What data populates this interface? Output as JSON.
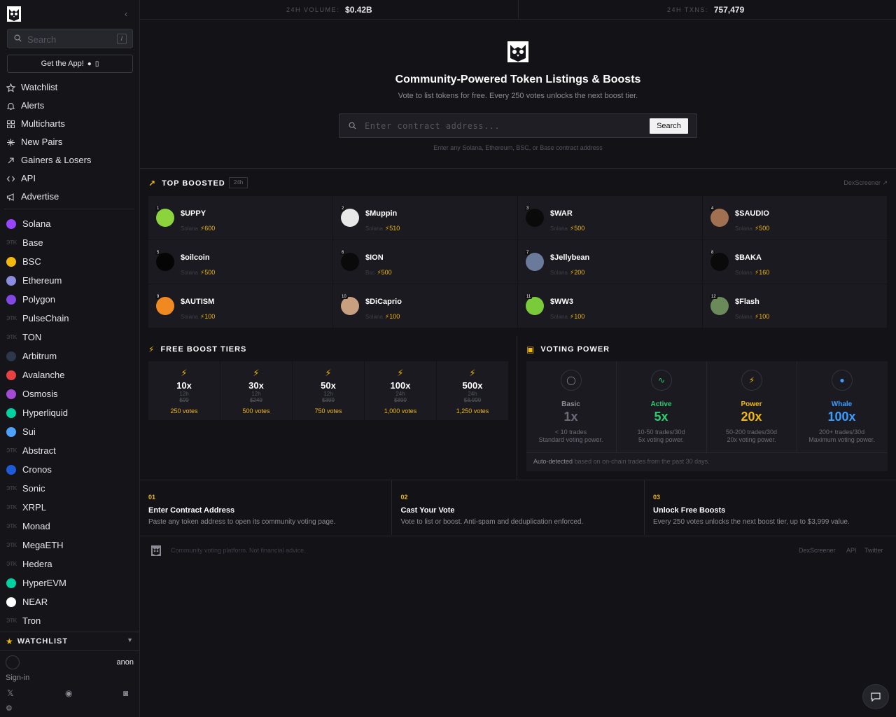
{
  "sidebar": {
    "search_placeholder": "Search",
    "search_shortcut": "/",
    "get_app_label": "Get the App!",
    "nav": [
      {
        "label": "Watchlist",
        "icon": "star-icon"
      },
      {
        "label": "Alerts",
        "icon": "bell-icon"
      },
      {
        "label": "Multicharts",
        "icon": "grid-icon"
      },
      {
        "label": "New Pairs",
        "icon": "sparkle-icon"
      },
      {
        "label": "Gainers & Losers",
        "icon": "arrow-up-right-icon"
      },
      {
        "label": "API",
        "icon": "code-icon"
      },
      {
        "label": "Advertise",
        "icon": "megaphone-icon"
      }
    ],
    "chains": [
      {
        "label": "Solana",
        "color": "#9945ff"
      },
      {
        "label": "Base",
        "color": ""
      },
      {
        "label": "BSC",
        "color": "#f0b90b"
      },
      {
        "label": "Ethereum",
        "color": "#8c8ce0"
      },
      {
        "label": "Polygon",
        "color": "#8247e5"
      },
      {
        "label": "PulseChain",
        "color": ""
      },
      {
        "label": "TON",
        "color": ""
      },
      {
        "label": "Arbitrum",
        "color": "#2d374b"
      },
      {
        "label": "Avalanche",
        "color": "#e84142"
      },
      {
        "label": "Osmosis",
        "color": "#a34bd4"
      },
      {
        "label": "Hyperliquid",
        "color": "#00d1a0"
      },
      {
        "label": "Sui",
        "color": "#4da2ff"
      },
      {
        "label": "Abstract",
        "color": ""
      },
      {
        "label": "Cronos",
        "color": "#1f5bd8"
      },
      {
        "label": "Sonic",
        "color": ""
      },
      {
        "label": "XRPL",
        "color": ""
      },
      {
        "label": "Monad",
        "color": ""
      },
      {
        "label": "MegaETH",
        "color": ""
      },
      {
        "label": "Hedera",
        "color": ""
      },
      {
        "label": "HyperEVM",
        "color": "#00d1a0"
      },
      {
        "label": "NEAR",
        "color": "#ffffff"
      },
      {
        "label": "Tron",
        "color": ""
      }
    ],
    "watchlist_label": "WATCHLIST",
    "user_name": "anon",
    "signin_label": "Sign-in"
  },
  "stats": {
    "volume_label": "24H VOLUME:",
    "volume_value": "$0.42B",
    "txns_label": "24H TXNS:",
    "txns_value": "757,479"
  },
  "hero": {
    "title": "Community-Powered Token Listings & Boosts",
    "subtitle": "Vote to list tokens for free. Every 250 votes unlocks the next boost tier.",
    "input_placeholder": "Enter contract address...",
    "search_button": "Search",
    "note": "Enter any Solana, Ethereum, BSC, or Base contract address"
  },
  "top_boosted": {
    "title": "TOP BOOSTED",
    "badge": "24h",
    "source_link": "DexScreener",
    "tokens": [
      {
        "rank": "1",
        "ticker": "$UPPY",
        "chain": "Solana",
        "boosts": "600",
        "color": "#8bd43c"
      },
      {
        "rank": "2",
        "ticker": "$Muppin",
        "chain": "Solana",
        "boosts": "510",
        "color": "#e8e8e8"
      },
      {
        "rank": "3",
        "ticker": "$WAR",
        "chain": "Solana",
        "boosts": "500",
        "color": "#0a0a0a"
      },
      {
        "rank": "4",
        "ticker": "$SAUDIO",
        "chain": "Solana",
        "boosts": "500",
        "color": "#a07050"
      },
      {
        "rank": "5",
        "ticker": "$oilcoin",
        "chain": "Solana",
        "boosts": "500",
        "color": "#050505"
      },
      {
        "rank": "6",
        "ticker": "$ION",
        "chain": "Bsc",
        "boosts": "500",
        "color": "#0a0a0a"
      },
      {
        "rank": "7",
        "ticker": "$Jellybean",
        "chain": "Solana",
        "boosts": "200",
        "color": "#6a7a9a"
      },
      {
        "rank": "8",
        "ticker": "$BAKA",
        "chain": "Solana",
        "boosts": "160",
        "color": "#0a0a0a"
      },
      {
        "rank": "9",
        "ticker": "$AUTISM",
        "chain": "Solana",
        "boosts": "100",
        "color": "#f08a20"
      },
      {
        "rank": "10",
        "ticker": "$DiCaprio",
        "chain": "Solana",
        "boosts": "100",
        "color": "#c8a080"
      },
      {
        "rank": "11",
        "ticker": "$WW3",
        "chain": "Solana",
        "boosts": "100",
        "color": "#7acb3a"
      },
      {
        "rank": "12",
        "ticker": "$Flash",
        "chain": "Solana",
        "boosts": "100",
        "color": "#6a8a5a"
      }
    ]
  },
  "boost_tiers": {
    "title": "FREE BOOST TIERS",
    "tiers": [
      {
        "mult": "10x",
        "duration": "12h",
        "price": "$99",
        "votes": "250 votes"
      },
      {
        "mult": "30x",
        "duration": "12h",
        "price": "$249",
        "votes": "500 votes"
      },
      {
        "mult": "50x",
        "duration": "12h",
        "price": "$399",
        "votes": "750 votes"
      },
      {
        "mult": "100x",
        "duration": "24h",
        "price": "$899",
        "votes": "1,000 votes"
      },
      {
        "mult": "500x",
        "duration": "24h",
        "price": "$3,999",
        "votes": "1,250 votes"
      }
    ]
  },
  "voting_power": {
    "title": "VOTING POWER",
    "levels": [
      {
        "name": "Basic",
        "mult": "1x",
        "desc1": "< 10 trades",
        "desc2": "Standard voting power.",
        "color": "#8c8c96",
        "mult_color": "#6c6c78",
        "icon": "user-icon"
      },
      {
        "name": "Active",
        "mult": "5x",
        "desc1": "10-50 trades/30d",
        "desc2": "5x voting power.",
        "color": "#2ecc71",
        "mult_color": "#2ecc71",
        "icon": "activity-icon"
      },
      {
        "name": "Power",
        "mult": "20x",
        "desc1": "50-200 trades/30d",
        "desc2": "20x voting power.",
        "color": "#f0b90b",
        "mult_color": "#f0b90b",
        "icon": "bolt-icon"
      },
      {
        "name": "Whale",
        "mult": "100x",
        "desc1": "200+ trades/30d",
        "desc2": "Maximum voting power.",
        "color": "#3b9cff",
        "mult_color": "#3b9cff",
        "icon": "whale-icon"
      }
    ],
    "footnote_strong": "Auto-detected",
    "footnote_rest": " based on on-chain trades from the past 30 days."
  },
  "steps": [
    {
      "num": "01",
      "title": "Enter Contract Address",
      "desc": "Paste any token address to open its community voting page."
    },
    {
      "num": "02",
      "title": "Cast Your Vote",
      "desc": "Vote to list or boost. Anti-spam and deduplication enforced."
    },
    {
      "num": "03",
      "title": "Unlock Free Boosts",
      "desc": "Every 250 votes unlocks the next boost tier, up to $3,999 value."
    }
  ],
  "footer": {
    "disclaimer": "Community voting platform. Not financial advice.",
    "links": [
      "DexScreener",
      "API",
      "Twitter"
    ]
  }
}
